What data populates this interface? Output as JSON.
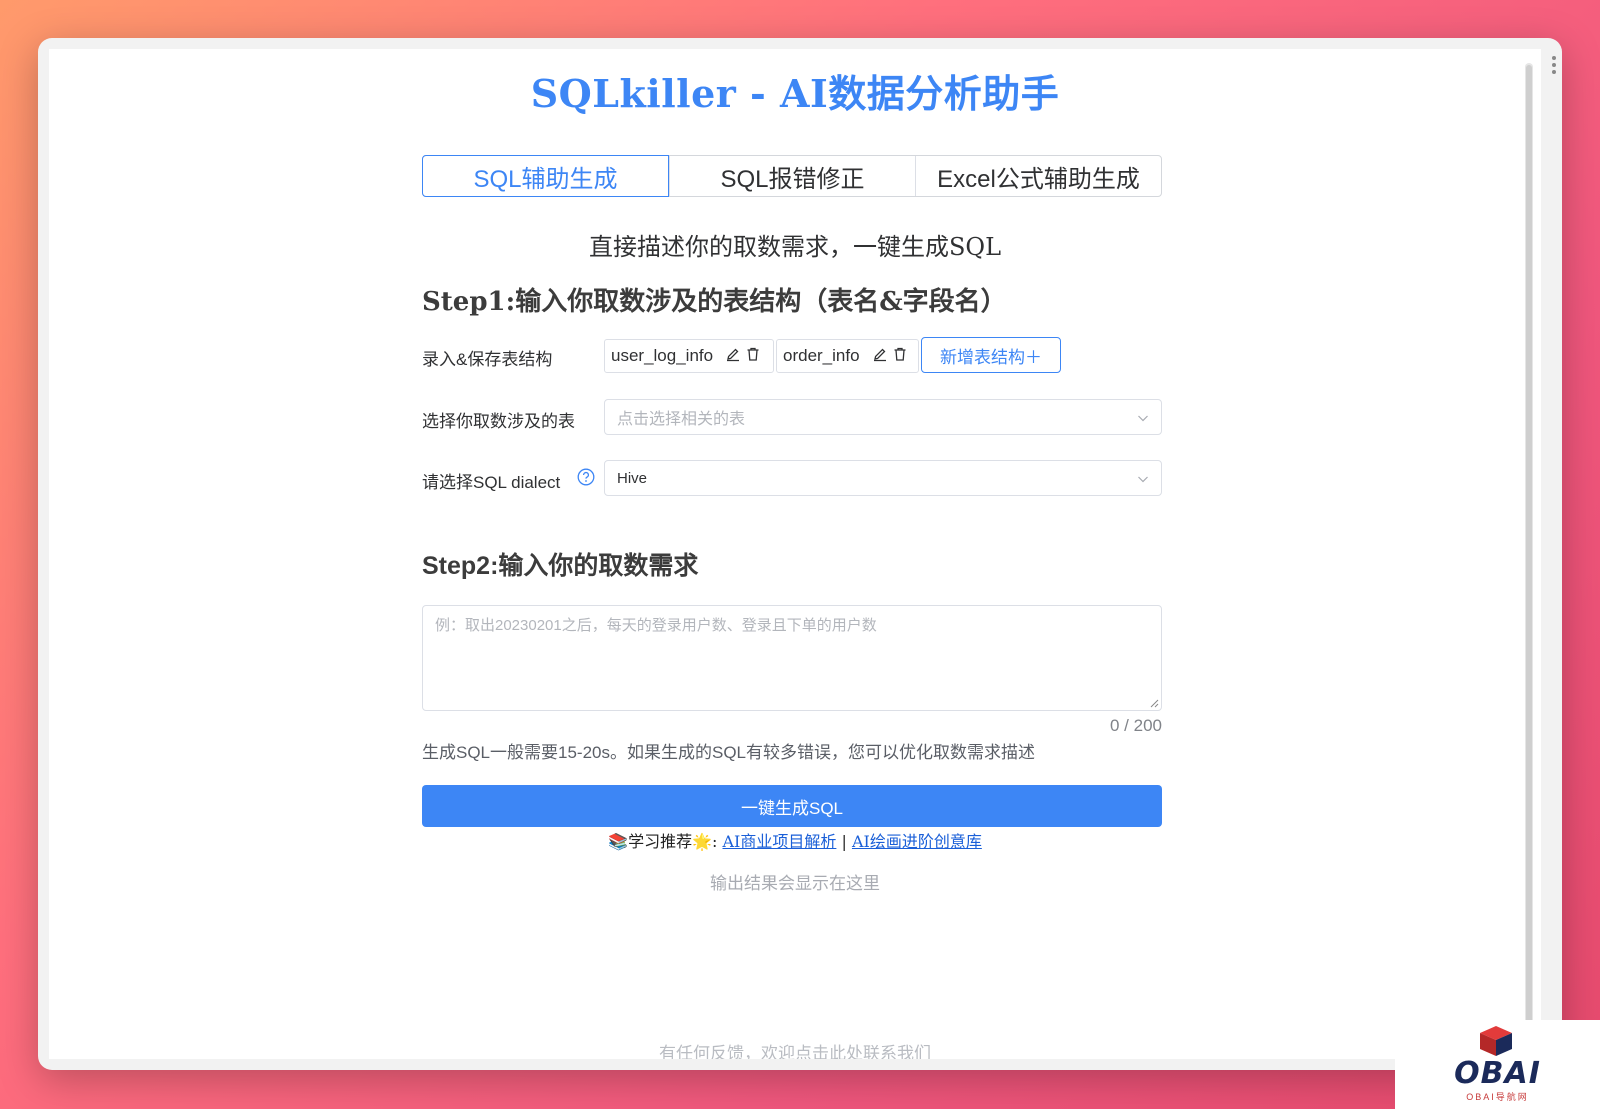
{
  "app": {
    "title": "SQLkiller - AI数据分析助手"
  },
  "tabs": [
    {
      "label": "SQL辅助生成",
      "active": true
    },
    {
      "label": "SQL报错修正",
      "active": false
    },
    {
      "label": "Excel公式辅助生成",
      "active": false
    }
  ],
  "subtitle": "直接描述你的取数需求，一键生成SQL",
  "step1": {
    "title": "Step1:输入你取数涉及的表结构（表名&字段名）",
    "save_label": "录入&保存表结构",
    "tables": [
      "user_log_info",
      "order_info"
    ],
    "add_table_label": "新增表结构＋",
    "select_tables_label": "选择你取数涉及的表",
    "select_tables_placeholder": "点击选择相关的表",
    "dialect_label": "请选择SQL dialect",
    "dialect_value": "Hive"
  },
  "step2": {
    "title": "Step2:输入你的取数需求",
    "placeholder": "例：取出20230201之后，每天的登录用户数、登录且下单的用户数",
    "counter": "0 / 200",
    "hint": "生成SQL一般需要15-20s。如果生成的SQL有较多错误，您可以优化取数需求描述",
    "generate_label": "一键生成SQL"
  },
  "recommend": {
    "prefix": "📚学习推荐🌟:",
    "link1": "AI商业项目解析",
    "separator": " | ",
    "link2": "AI绘画进阶创意库"
  },
  "output_placeholder": "输出结果会显示在这里",
  "footer": "有任何反馈，欢迎点击此处联系我们",
  "watermark": {
    "brand": "OBAI",
    "sub": "OBAI导航网"
  },
  "colors": {
    "accent": "#3d86f5",
    "brand_dark": "#1b2a5a",
    "brand_red": "#c73a3a"
  }
}
